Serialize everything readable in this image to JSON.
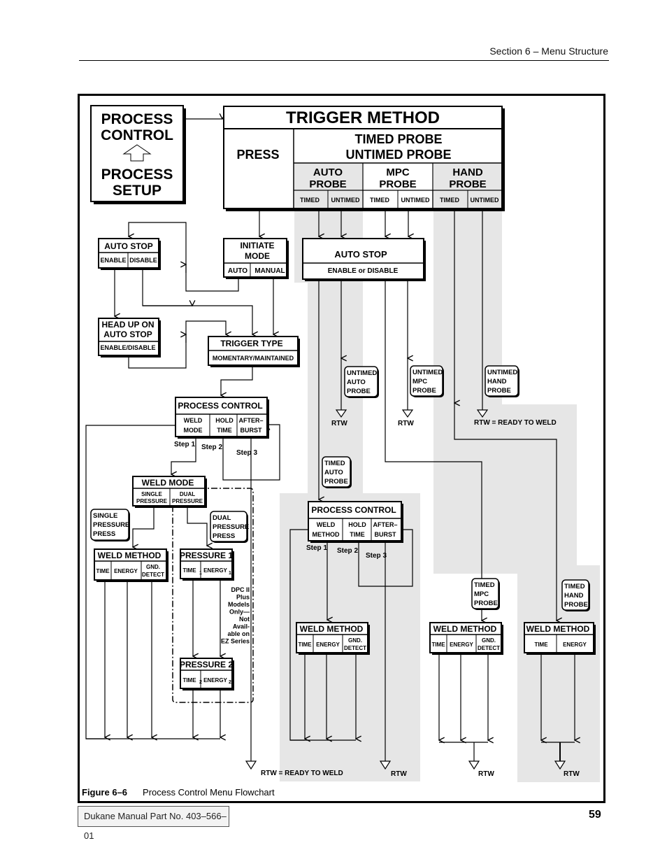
{
  "header": {
    "section": "Section 6 – Menu Structure"
  },
  "footer": {
    "manual_part": "Dukane Manual Part No. 403–566–01",
    "page_number": "59"
  },
  "figure": {
    "label": "Figure 6–6",
    "title": "Process Control Menu Flowchart"
  },
  "colors": {
    "shade": "#e6e6e6",
    "line": "#000000"
  },
  "diagram": {
    "process_box": {
      "line1": "PROCESS",
      "line2": "CONTROL",
      "line3": "PROCESS",
      "line4": "SETUP"
    },
    "trigger_method": {
      "title": "TRIGGER  METHOD",
      "press": "PRESS",
      "probe_line1": "TIMED  PROBE",
      "probe_line2": "UNTIMED  PROBE",
      "probes": [
        {
          "l1": "AUTO",
          "l2": "PROBE"
        },
        {
          "l1": "MPC",
          "l2": "PROBE"
        },
        {
          "l1": "HAND",
          "l2": "PROBE"
        }
      ],
      "timed": "TIMED",
      "untimed": "UNTIMED"
    },
    "auto_stop_left": {
      "title": "AUTO STOP",
      "opt1": "ENABLE",
      "opt2": "DISABLE"
    },
    "initiate_mode": {
      "l1": "INITIATE",
      "l2": "MODE",
      "opt1": "AUTO",
      "opt2": "MANUAL"
    },
    "auto_stop_right": {
      "title": "AUTO  STOP",
      "opt": "ENABLE or DISABLE"
    },
    "head_up": {
      "l1": "HEAD UP ON",
      "l2": "AUTO STOP",
      "opt": "ENABLE/DISABLE"
    },
    "trigger_type": {
      "title": "TRIGGER  TYPE",
      "opt": "MOMENTARY/MAINTAINED"
    },
    "process_control_1": {
      "title": "PROCESS  CONTROL",
      "c1a": "WELD",
      "c1b": "MODE",
      "c2a": "HOLD",
      "c2b": "TIME",
      "c3a": "AFTER–",
      "c3b": "BURST"
    },
    "process_control_2": {
      "title": "PROCESS  CONTROL",
      "c1a": "WELD",
      "c1b": "METHOD",
      "c2a": "HOLD",
      "c2b": "TIME",
      "c3a": "AFTER–",
      "c3b": "BURST"
    },
    "steps": {
      "s1": "Step 1",
      "s2": "Step 2",
      "s3": "Step 3"
    },
    "weld_mode": {
      "title": "WELD MODE",
      "o1a": "SINGLE",
      "o1b": "PRESSURE",
      "o2a": "DUAL",
      "o2b": "PRESSURE"
    },
    "notes": {
      "single_press": [
        "SINGLE",
        "PRESSURE",
        "PRESS"
      ],
      "dual_press": [
        "DUAL",
        "PRESSURE",
        "PRESS"
      ],
      "untimed_auto": [
        "UNTIMED",
        "AUTO",
        "PROBE"
      ],
      "untimed_mpc": [
        "UNTIMED",
        "MPC",
        "PROBE"
      ],
      "untimed_hand": [
        "UNTIMED",
        "HAND",
        "PROBE"
      ],
      "timed_auto": [
        "TIMED",
        "AUTO",
        "PROBE"
      ],
      "timed_mpc": [
        "TIMED",
        "MPC",
        "PROBE"
      ],
      "timed_hand": [
        "TIMED",
        "HAND",
        "PROBE"
      ]
    },
    "weld_method": {
      "title": "WELD METHOD",
      "time": "TIME",
      "energy": "ENERGY",
      "gnd1": "GND.",
      "gnd2": "DETECT"
    },
    "pressure1": {
      "title": "PRESSURE 1",
      "time": "TIME",
      "energy": "ENERGY",
      "sub": "1"
    },
    "pressure2": {
      "title": "PRESSURE 2",
      "time": "TIME",
      "energy": "ENERGY",
      "sub": "2"
    },
    "dpc_note": [
      "DPC II",
      "Plus",
      "Models",
      "Only—",
      "Not",
      "Avail-",
      "able on",
      "EZ Series"
    ],
    "rtw": "RTW",
    "rtw_legend": "RTW =  READY TO WELD"
  }
}
